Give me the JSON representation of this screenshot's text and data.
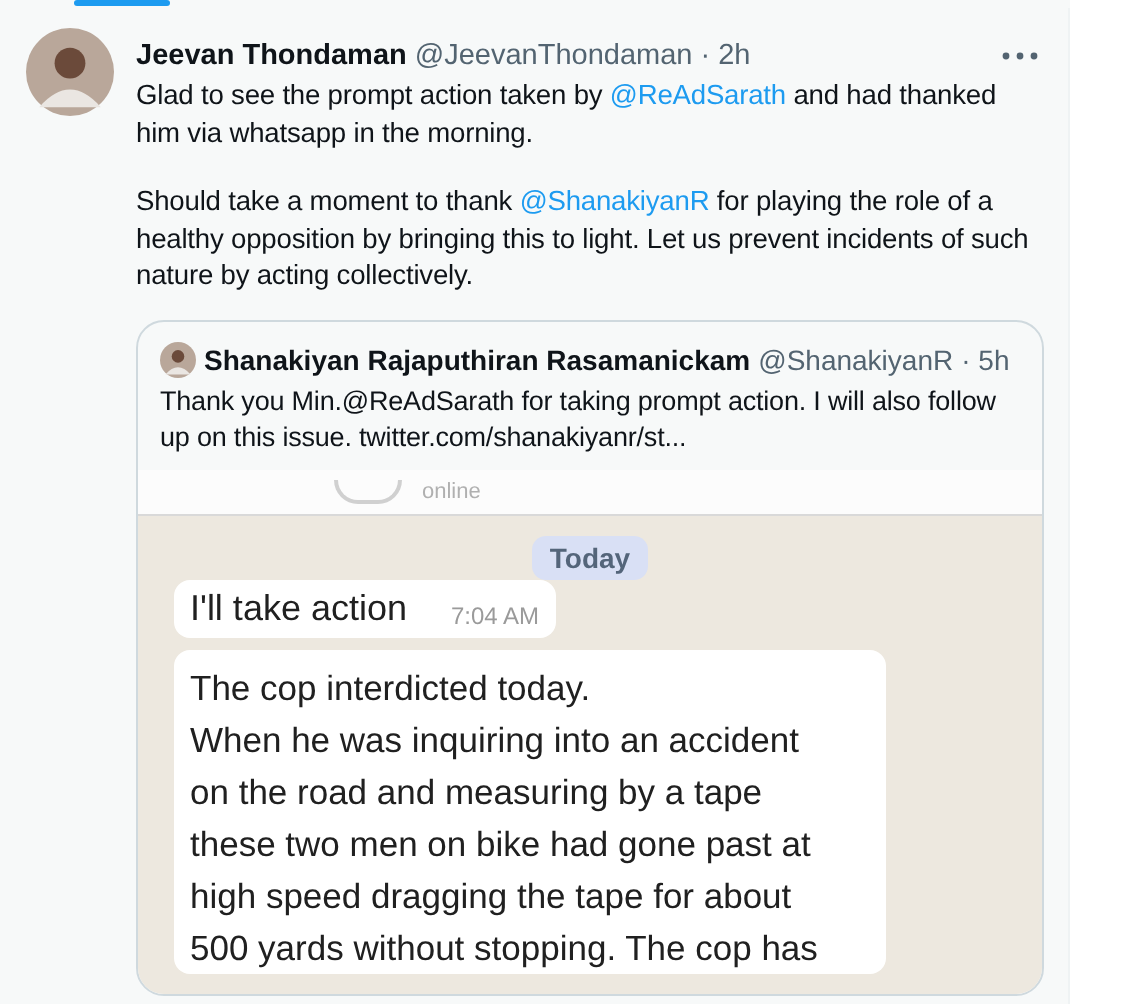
{
  "tweet": {
    "author": {
      "name": "Jeevan Thondaman",
      "handle": "@JeevanThondaman",
      "time": "· 2h"
    },
    "paragraphs": [
      [
        {
          "kind": "text",
          "text": "Glad to see the prompt action taken by "
        },
        {
          "kind": "mention",
          "text": "@ReAdSarath"
        },
        {
          "kind": "text",
          "text": " and had thanked him via whatsapp in the morning."
        }
      ],
      [
        {
          "kind": "text",
          "text": "Should take a moment to thank "
        },
        {
          "kind": "mention",
          "text": "@ShanakiyanR"
        },
        {
          "kind": "text",
          "text": " for playing the role of a healthy opposition by bringing this to light. Let us prevent incidents of such nature by acting collectively."
        }
      ]
    ],
    "quote": {
      "author": {
        "name": "Shanakiyan Rajaputhiran Rasamanickam",
        "handle": "@ShanakiyanR",
        "time": "· 5h"
      },
      "text": "Thank you Min.@ReAdSarath for taking prompt action. I will also follow up on this issue.  twitter.com/shanakiyanr/st...",
      "chat_screenshot": {
        "contact_status": "online",
        "date_chip": "Today",
        "messages": [
          {
            "text": "I'll take action",
            "time": "7:04 AM"
          },
          {
            "text": "The cop interdicted today.\nWhen he was inquiring into an accident\non the road and measuring by a tape\nthese two men on bike had gone past at\nhigh speed dragging the tape for about\n500 yards without stopping. The cop has"
          }
        ]
      }
    }
  }
}
